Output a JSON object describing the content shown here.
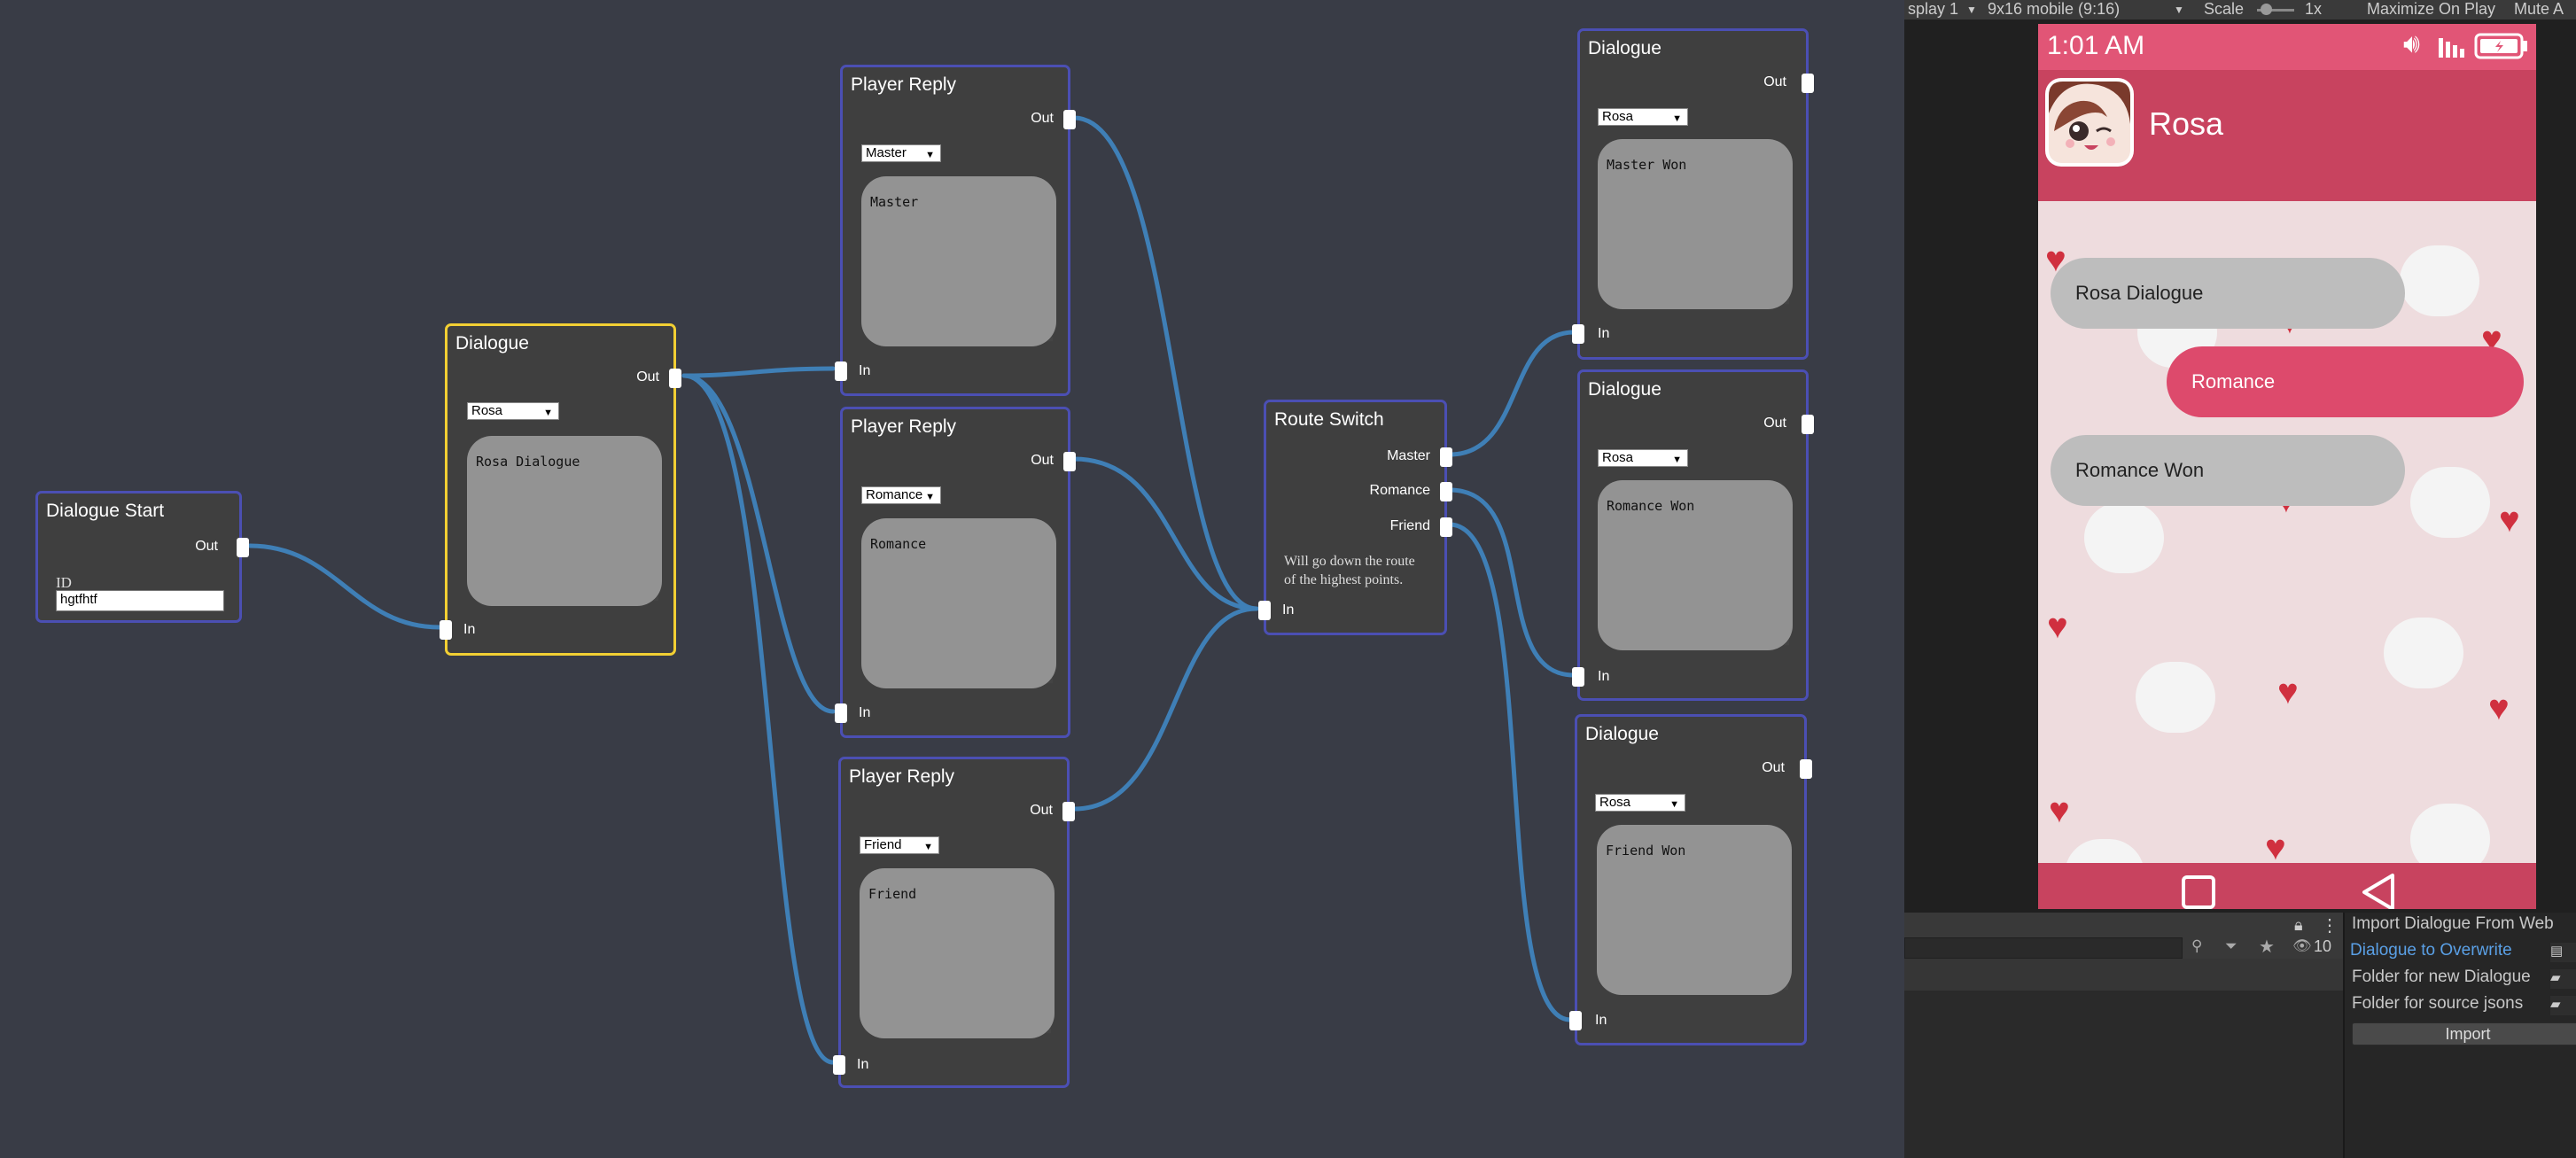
{
  "nodes": {
    "start": {
      "title": "Dialogue Start",
      "out": "Out",
      "id_label": "ID",
      "id_value": "hgtfhtf"
    },
    "dialogue_main": {
      "title": "Dialogue",
      "out": "Out",
      "in": "In",
      "speaker": "Rosa",
      "text": "Rosa Dialogue"
    },
    "reply_master": {
      "title": "Player Reply",
      "out": "Out",
      "in": "In",
      "route": "Master",
      "text": "Master"
    },
    "reply_romance": {
      "title": "Player Reply",
      "out": "Out",
      "in": "In",
      "route": "Romance",
      "text": "Romance"
    },
    "reply_friend": {
      "title": "Player Reply",
      "out": "Out",
      "in": "In",
      "route": "Friend",
      "text": "Friend"
    },
    "route_switch": {
      "title": "Route Switch",
      "in": "In",
      "master": "Master",
      "romance": "Romance",
      "friend": "Friend",
      "note_line1": "Will go down the route",
      "note_line2": "of the highest points."
    },
    "dialogue_master": {
      "title": "Dialogue",
      "out": "Out",
      "in": "In",
      "speaker": "Rosa",
      "text": "Master Won"
    },
    "dialogue_romance": {
      "title": "Dialogue",
      "out": "Out",
      "in": "In",
      "speaker": "Rosa",
      "text": "Romance Won"
    },
    "dialogue_friend": {
      "title": "Dialogue",
      "out": "Out",
      "in": "In",
      "speaker": "Rosa",
      "text": "Friend Won"
    }
  },
  "game_toolbar": {
    "display": "splay 1",
    "resolution": "9x16 mobile (9:16)",
    "scale_label": "Scale",
    "scale_value": "1x",
    "maximize": "Maximize On Play",
    "mute": "Mute A"
  },
  "phone": {
    "time": "1:01 AM",
    "contact_name": "Rosa",
    "messages": [
      {
        "text": "Rosa Dialogue",
        "side": "left"
      },
      {
        "text": "Romance",
        "side": "right"
      },
      {
        "text": "Romance Won",
        "side": "left"
      }
    ],
    "colors": {
      "statusbar": "#e15576",
      "appbar": "#c8435f",
      "bubble_left": "#bdbdbd",
      "bubble_right": "#dd4a6c",
      "background": "#eedcde"
    }
  },
  "project_panel": {
    "hidden_count": "10"
  },
  "inspector": {
    "title": "Import Dialogue From Web",
    "dialogue_to_overwrite": "Dialogue to Overwrite",
    "folder_new": "Folder for new Dialogue",
    "folder_source": "Folder for source jsons",
    "import_button": "Import"
  },
  "colors": {
    "wire": "#3f7fb6",
    "node_border": "#4b4fb3",
    "selected_border": "#f2cf33",
    "graph_bg": "#393c46"
  }
}
